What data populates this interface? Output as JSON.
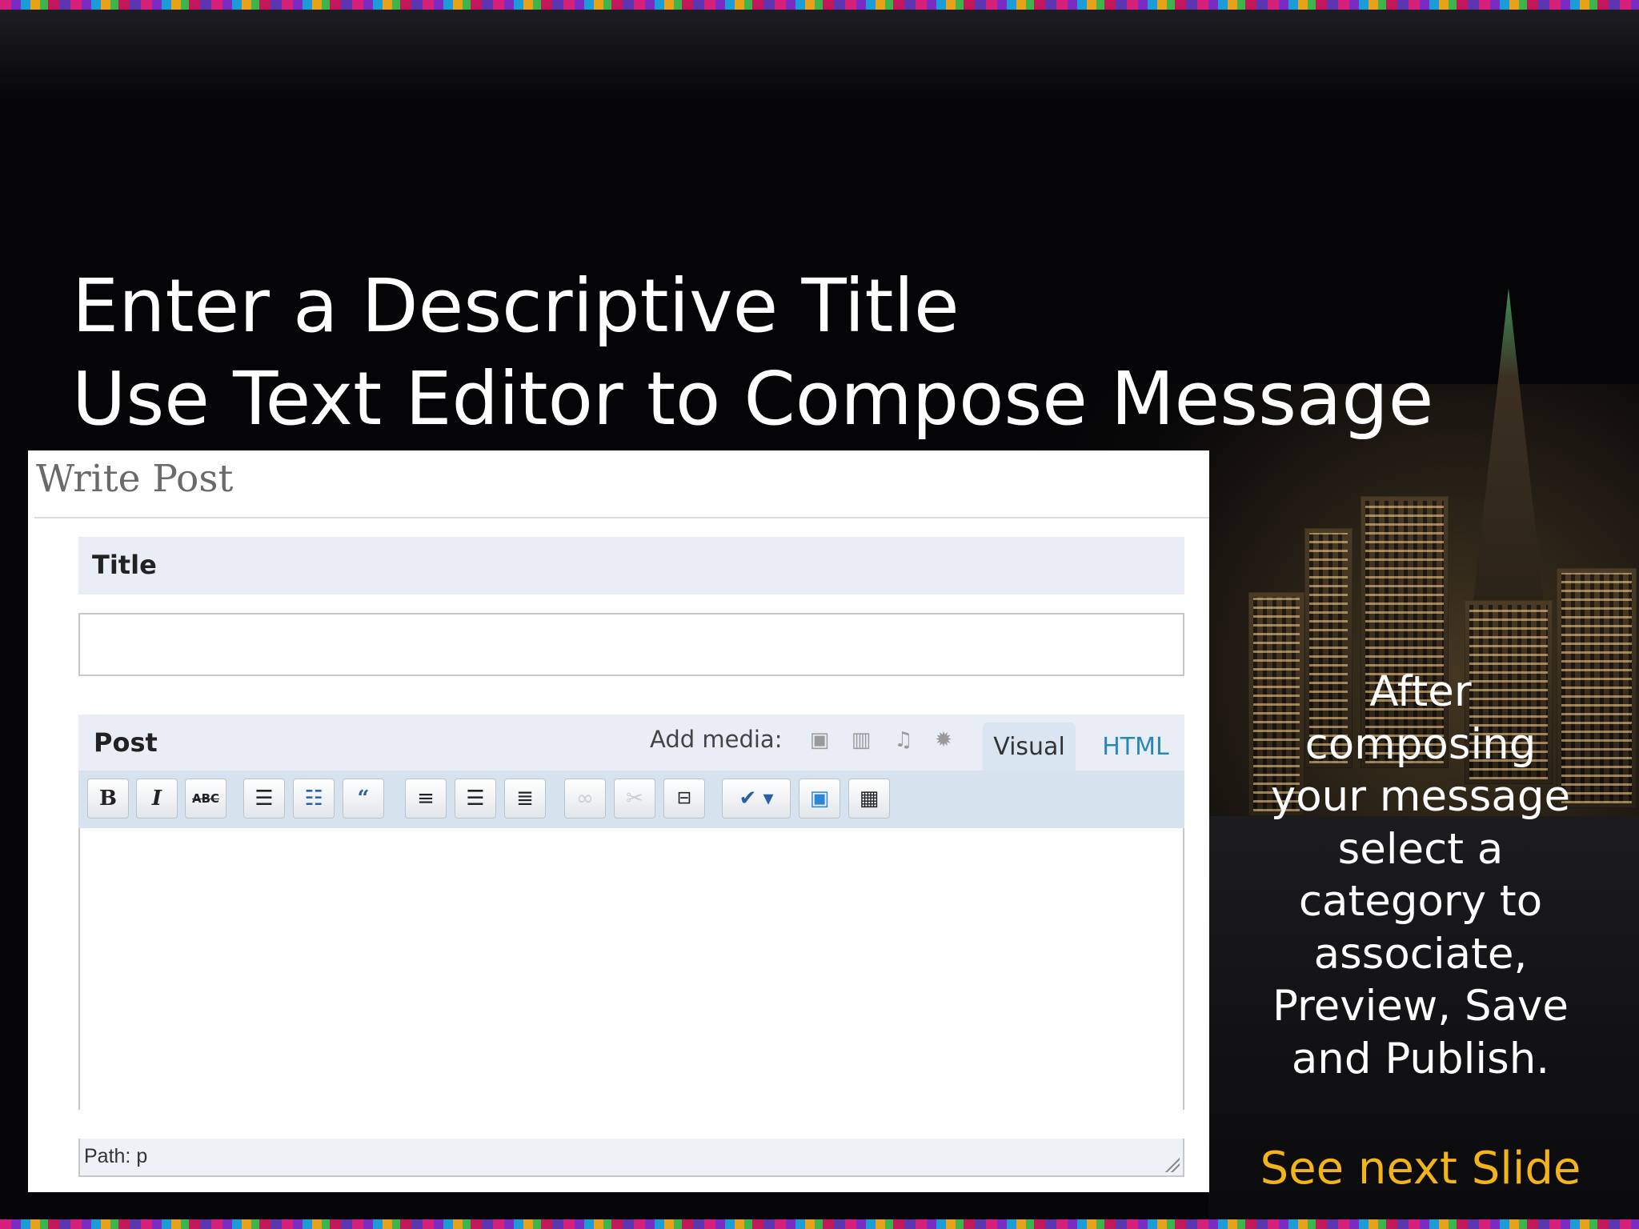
{
  "slide": {
    "title_lines": [
      "Enter a Descriptive Title",
      "Use Text Editor to Compose Message"
    ],
    "side_note_lines": [
      "After",
      "composing",
      "your message",
      "select a",
      "category to",
      "associate,",
      "Preview, Save",
      "and Publish."
    ],
    "footer_link": "See next Slide",
    "colors": {
      "background": "#050507",
      "title": "#ffffff",
      "footer_link": "#f2b418"
    }
  },
  "write_post": {
    "heading": "Write Post",
    "title_label": "Title",
    "title_value": "",
    "post_label": "Post",
    "add_media_label": "Add media:",
    "media_icons": [
      "image-icon",
      "video-icon",
      "audio-icon",
      "media-star-icon"
    ],
    "tabs": {
      "visual": "Visual",
      "html": "HTML",
      "active": "Visual"
    },
    "toolbar": {
      "bold": "B",
      "italic": "I",
      "strikethrough": "ABC",
      "buttons": [
        "bold-icon",
        "italic-icon",
        "strikethrough-icon",
        "bullet-list-icon",
        "numbered-list-icon",
        "blockquote-icon",
        "align-left-icon",
        "align-center-icon",
        "align-right-icon",
        "link-icon",
        "unlink-icon",
        "more-tag-icon",
        "spellcheck-icon",
        "fullscreen-icon",
        "kitchen-sink-icon"
      ]
    },
    "editor_content": "",
    "status_path": "Path: p"
  }
}
